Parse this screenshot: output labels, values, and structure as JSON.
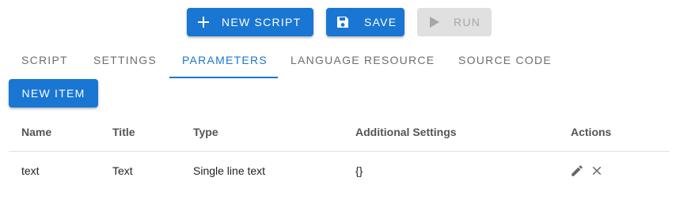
{
  "toolbar": {
    "new_script_label": "NEW SCRIPT",
    "save_label": "SAVE",
    "run_label": "RUN",
    "primary_color": "#1976d2",
    "disabled_color": "#e0e0e0"
  },
  "tabs": [
    {
      "label": "SCRIPT",
      "active": false
    },
    {
      "label": "SETTINGS",
      "active": false
    },
    {
      "label": "PARAMETERS",
      "active": true
    },
    {
      "label": "LANGUAGE RESOURCE",
      "active": false
    },
    {
      "label": "SOURCE CODE",
      "active": false
    }
  ],
  "new_item_label": "NEW ITEM",
  "table": {
    "headers": [
      "Name",
      "Title",
      "Type",
      "Additional Settings",
      "Actions"
    ],
    "rows": [
      {
        "name": "text",
        "title": "Text",
        "type": "Single line text",
        "settings": "{}",
        "actions": [
          "edit-icon",
          "delete-icon"
        ]
      }
    ]
  }
}
